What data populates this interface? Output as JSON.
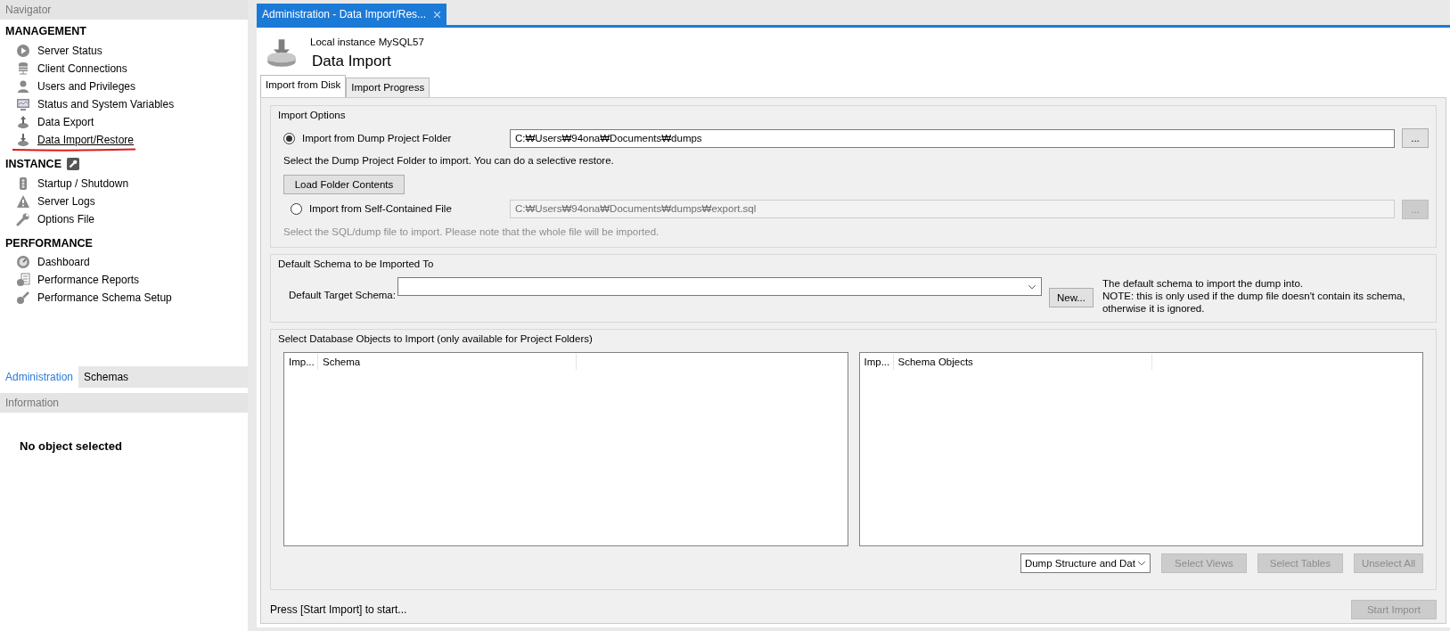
{
  "navigator": {
    "title": "Navigator",
    "sections": [
      {
        "title": "MANAGEMENT",
        "items": [
          {
            "label": "Server Status",
            "selected": false
          },
          {
            "label": "Client Connections",
            "selected": false
          },
          {
            "label": "Users and Privileges",
            "selected": false
          },
          {
            "label": "Status and System Variables",
            "selected": false
          },
          {
            "label": "Data Export",
            "selected": false
          },
          {
            "label": "Data Import/Restore",
            "selected": true
          }
        ]
      },
      {
        "title": "INSTANCE",
        "items": [
          {
            "label": "Startup / Shutdown",
            "selected": false
          },
          {
            "label": "Server Logs",
            "selected": false
          },
          {
            "label": "Options File",
            "selected": false
          }
        ]
      },
      {
        "title": "PERFORMANCE",
        "items": [
          {
            "label": "Dashboard",
            "selected": false
          },
          {
            "label": "Performance Reports",
            "selected": false
          },
          {
            "label": "Performance Schema Setup",
            "selected": false
          }
        ]
      }
    ]
  },
  "sidebar_tabs": [
    {
      "label": "Administration",
      "selected": true
    },
    {
      "label": "Schemas",
      "selected": false
    }
  ],
  "information": {
    "title": "Information",
    "message": "No object selected"
  },
  "document_tab": {
    "title": "Administration - Data Import/Res..."
  },
  "header": {
    "subtitle": "Local instance MySQL57",
    "title": "Data Import"
  },
  "tabs": [
    {
      "label": "Import from Disk",
      "selected": true
    },
    {
      "label": "Import Progress",
      "selected": false
    }
  ],
  "import_options": {
    "title": "Import Options",
    "options": [
      {
        "label": "Import from Dump Project Folder",
        "selected": true,
        "path": "C:₩Users₩94ona₩Documents₩dumps",
        "browse": "...",
        "hint": "Select the Dump Project Folder to import. You can do a selective restore.",
        "button": "Load Folder Contents"
      },
      {
        "label": "Import from Self-Contained File",
        "selected": false,
        "path": "C:₩Users₩94ona₩Documents₩dumps₩export.sql",
        "browse": "...",
        "hint": "Select the SQL/dump file to import. Please note that the whole file will be imported."
      }
    ]
  },
  "default_schema": {
    "title": "Default Schema to be Imported To",
    "label": "Default Target Schema:",
    "button": "New...",
    "notes": [
      "The default schema to import the dump into.",
      "NOTE: this is only used if the dump file doesn't contain its schema,",
      "otherwise it is ignored."
    ]
  },
  "objects": {
    "title": "Select Database Objects to Import (only available for Project Folders)",
    "tables": [
      {
        "columns": [
          "Imp...",
          "Schema"
        ]
      },
      {
        "columns": [
          "Imp...",
          "Schema Objects"
        ]
      }
    ],
    "dump_select": "Dump Structure and Dat",
    "buttons": [
      {
        "label": "Select Views",
        "disabled": true
      },
      {
        "label": "Select Tables",
        "disabled": true
      },
      {
        "label": "Unselect All",
        "disabled": true
      }
    ]
  },
  "status": {
    "text": "Press [Start Import] to start...",
    "button": {
      "label": "Start Import",
      "disabled": true
    }
  }
}
